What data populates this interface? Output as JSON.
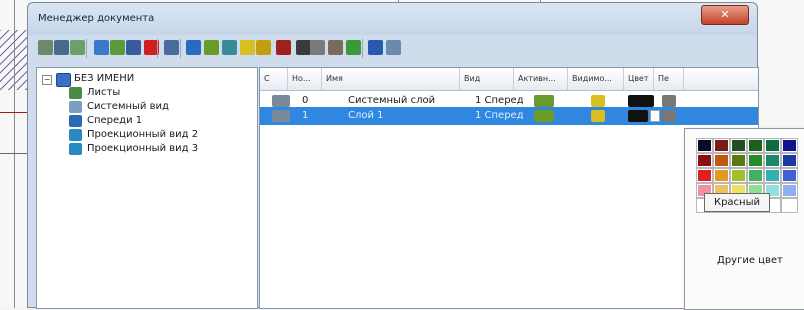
{
  "window": {
    "title": "Менеджер документа",
    "close_glyph": "✕"
  },
  "toolbar": {
    "icons": [
      "refresh-icon",
      "tree-icon",
      "view-icon",
      "layer-icon",
      "copy-icon",
      "filter-icon",
      "delete-icon",
      "grid-icon",
      "undo-icon",
      "layer-add-icon",
      "layer-props-icon",
      "bulb-icon",
      "bulb-off-icon",
      "color-icon",
      "dropdown-icon",
      "print-icon",
      "printer-icon",
      "image-icon",
      "blue-table-icon",
      "settings-icon"
    ]
  },
  "tree": {
    "root": "БЕЗ ИМЕНИ",
    "items": [
      {
        "label": "Листы",
        "icon": "sheets-icon"
      },
      {
        "label": "Системный вид",
        "icon": "system-view-icon"
      },
      {
        "label": "Спереди 1",
        "icon": "front-view-icon"
      },
      {
        "label": "Проекционный вид 2",
        "icon": "projection-view-icon"
      },
      {
        "label": "Проекционный вид 3",
        "icon": "projection-view-icon"
      }
    ]
  },
  "table": {
    "columns": [
      "С",
      "Но...",
      "Имя",
      "Вид",
      "Активн...",
      "Видимо...",
      "Цвет",
      "Пе"
    ],
    "rows": [
      {
        "number": "0",
        "name": "Системный слой",
        "view": "1 Сперед",
        "selected": false
      },
      {
        "number": "1",
        "name": "Слой 1",
        "view": "1 Сперед",
        "selected": true
      }
    ]
  },
  "color_popup": {
    "tooltip": "Красный",
    "more_colors": "Другие цвет",
    "swatches": [
      [
        "#0a0a28",
        "#7a1a1a",
        "#1f4f1f",
        "#1d5f1d",
        "#0d6b3f",
        "#12128a"
      ],
      [
        "#8a1010",
        "#c05a10",
        "#5a7a10",
        "#2a8a2a",
        "#1a8a6a",
        "#1a3aa0"
      ],
      [
        "#e02020",
        "#e09a20",
        "#a0c030",
        "#40b060",
        "#30b0b0",
        "#4060d0"
      ],
      [
        "#f090a0",
        "#f0c060",
        "#f0e060",
        "#90e090",
        "#90e0e0",
        "#90b0f0"
      ],
      [
        "#ffffff",
        "#ffffff",
        "#ffffff",
        "#ffffff",
        "#ffffff",
        "#ffffff"
      ]
    ]
  }
}
